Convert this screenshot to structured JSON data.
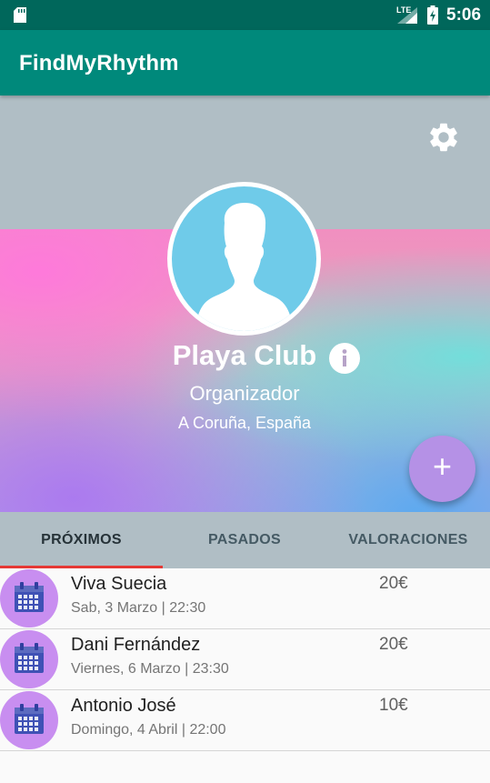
{
  "status_bar": {
    "network": "LTE",
    "time": "5:06",
    "icons": [
      "sd-card-icon",
      "signal-icon",
      "battery-charging-icon"
    ]
  },
  "app_bar": {
    "title": "FindMyRhythm",
    "color": "#00897b"
  },
  "profile": {
    "name": "Playa Club",
    "role": "Organizador",
    "location": "A Coruña, España",
    "avatar": "default-person-avatar",
    "icons": [
      "gear-icon",
      "info-icon"
    ]
  },
  "fab": {
    "label": "+",
    "color": "#b591e6"
  },
  "tabs": [
    {
      "label": "PRÓXIMOS",
      "selected": true
    },
    {
      "label": "PASADOS",
      "selected": false
    },
    {
      "label": "VALORACIONES",
      "selected": false
    }
  ],
  "events": [
    {
      "title": "Viva Suecia",
      "date": "Sab, 3 Marzo | 22:30",
      "price": "20€",
      "icon": "calendar-icon"
    },
    {
      "title": "Dani Fernández",
      "date": "Viernes, 6 Marzo | 23:30",
      "price": "20€",
      "icon": "calendar-icon"
    },
    {
      "title": "Antonio José",
      "date": "Domingo, 4 Abril | 22:00",
      "price": "10€",
      "icon": "calendar-icon"
    }
  ],
  "colors": {
    "status_bar": "#00675b",
    "accent_indicator": "#e53935",
    "tab_background": "#b0bec5",
    "event_badge": "#c88ef0"
  }
}
